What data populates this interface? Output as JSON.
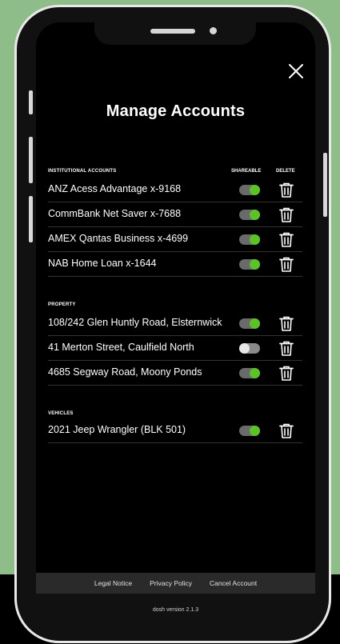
{
  "page": {
    "title": "Manage Accounts",
    "colors": {
      "background": "#8fbd8a",
      "toggle_on": "#5cc229",
      "toggle_off": "#e6e6e6"
    }
  },
  "columns": {
    "shareable": "SHAREABLE",
    "delete": "DELETE"
  },
  "sections": [
    {
      "heading": "INSTITUTIONAL ACCOUNTS",
      "items": [
        {
          "label": "ANZ Acess Advantage x-9168",
          "shareable": true
        },
        {
          "label": "CommBank Net Saver x-7688",
          "shareable": true
        },
        {
          "label": "AMEX Qantas Business x-4699",
          "shareable": true
        },
        {
          "label": "NAB Home Loan x-1644",
          "shareable": true
        }
      ]
    },
    {
      "heading": "PROPERTY",
      "items": [
        {
          "label": "108/242 Glen Huntly Road, Elsternwick",
          "shareable": true
        },
        {
          "label": "41 Merton Street, Caulfield North",
          "shareable": false
        },
        {
          "label": "4685 Segway Road, Moony Ponds",
          "shareable": true
        }
      ]
    },
    {
      "heading": "VEHICLES",
      "items": [
        {
          "label": "2021 Jeep Wrangler (BLK 501)",
          "shareable": true
        }
      ]
    }
  ],
  "footer": {
    "links": [
      "Legal Notice",
      "Privacy Policy",
      "Cancel Account"
    ],
    "version": "dosh version 2.1.3"
  },
  "icons": {
    "close": "close-icon",
    "delete": "trash-icon"
  }
}
